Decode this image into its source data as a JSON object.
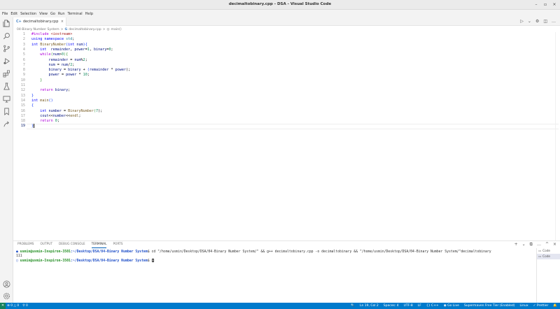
{
  "window": {
    "title": "decimaltobinary.cpp - DSA - Visual Studio Code"
  },
  "menu": [
    "File",
    "Edit",
    "Selection",
    "View",
    "Go",
    "Run",
    "Terminal",
    "Help"
  ],
  "tab": {
    "label": "decimaltobinary.cpp",
    "icon_text": "C+",
    "close": "×"
  },
  "breadcrumb": {
    "folder": "04-Binary Number System",
    "sep1": ">",
    "file_icon": "G",
    "file": "decimaltobinary.cpp",
    "sep2": ">",
    "symbol_icon": "◎",
    "symbol": "main()"
  },
  "editor": {
    "active_line": 19,
    "lines": [
      {
        "n": "1"
      },
      {
        "n": "2"
      },
      {
        "n": "3"
      },
      {
        "n": "4"
      },
      {
        "n": "5"
      },
      {
        "n": "6"
      },
      {
        "n": "7"
      },
      {
        "n": "8"
      },
      {
        "n": "9"
      },
      {
        "n": "10"
      },
      {
        "n": "11"
      },
      {
        "n": "12"
      },
      {
        "n": "13"
      },
      {
        "n": "14"
      },
      {
        "n": "15"
      },
      {
        "n": "16"
      },
      {
        "n": "17"
      },
      {
        "n": "18"
      },
      {
        "n": "19"
      }
    ],
    "code": {
      "l1_a": "#include",
      "l1_b": " <iostream>",
      "l2_a": "using",
      "l2_b": " namespace",
      "l2_c": " std",
      "l2_d": ";",
      "l3_a": "int",
      "l3_b": " BinaryNumber",
      "l3_c": "(",
      "l3_d": "int",
      "l3_e": " num",
      "l3_f": "){",
      "l4_a": "    int",
      "l4_b": "  remainder",
      "l4_c": ", ",
      "l4_d": "power",
      "l4_e": "=",
      "l4_f": "1",
      "l4_g": ", ",
      "l4_h": "binary",
      "l4_i": "=",
      "l4_j": "0",
      "l4_k": ";",
      "l5_a": "    while",
      "l5_b": "(",
      "l5_c": "num",
      "l5_d": ">",
      "l5_e": "0",
      "l5_f": "){",
      "l6_a": "        remainder",
      "l6_b": " = ",
      "l6_c": "num",
      "l6_d": "%",
      "l6_e": "2",
      "l6_f": ";",
      "l7_a": "        num",
      "l7_b": " = ",
      "l7_c": "num",
      "l7_d": "/",
      "l7_e": "2",
      "l7_f": ";",
      "l8_a": "        binary",
      "l8_b": " = ",
      "l8_c": "binary",
      "l8_d": " + ",
      "l8_e": "(",
      "l8_f": "remainder",
      "l8_g": " * ",
      "l8_h": "power",
      "l8_i": ");",
      "l9_a": "        power",
      "l9_b": " = ",
      "l9_c": "power",
      "l9_d": " * ",
      "l9_e": "10",
      "l9_f": ";",
      "l10_a": "    }",
      "l12_a": "    return",
      "l12_b": " binary",
      "l12_c": ";",
      "l13_a": "}",
      "l14_a": "int",
      "l14_b": " main",
      "l14_c": "()",
      "l15_a": "{",
      "l16_a": "    int",
      "l16_b": " number",
      "l16_c": " = ",
      "l16_d": "BinaryNumber",
      "l16_e": "(",
      "l16_f": "7",
      "l16_g": ");",
      "l17_a": "    cout",
      "l17_b": "<<",
      "l17_c": "number",
      "l17_d": "<<",
      "l17_e": "endl",
      "l17_f": ";",
      "l18_a": "    return",
      "l18_b": " 0",
      "l18_c": ";",
      "l19_a": "}"
    }
  },
  "panel": {
    "tabs": [
      "PROBLEMS",
      "OUTPUT",
      "DEBUG CONSOLE",
      "TERMINAL",
      "PORTS"
    ],
    "active_tab": "TERMINAL",
    "actions": [
      "+",
      "⌄",
      "⧉",
      "…",
      "^",
      "×"
    ],
    "terminal": {
      "line1_prompt": "usmin@usmin-Inspiron-3501",
      "line1_path": ":~/Desktop/DSA/04-Binary Number System",
      "line1_cmd": "$ cd \"/home/usmin/Desktop/DSA/04-Binary Number System/\" && g++ decimaltobinary.cpp -o decimaltobinary && \"/home/usmin/Desktop/DSA/04-Binary Number System/\"decimaltobinary",
      "line2": "111",
      "line3_prompt": "usmin@usmin-Inspiron-3501",
      "line3_path": ":~/Desktop/DSA/04-Binary Number System",
      "line3_cmd": "$ "
    },
    "terminal_list": [
      "Code",
      "Code"
    ]
  },
  "statusbar": {
    "remote": "✕",
    "errors": "⊗ 0 △ 0",
    "ports": "⚲ 0",
    "zoom_icon": "🔍",
    "position": "Ln 19, Col 2",
    "spaces": "Spaces: 4",
    "encoding": "UTF-8",
    "eol": "LF",
    "language": "{} C++",
    "golive": "◉ Go Live",
    "extension": "Supermaven Free Tier (Enabled)",
    "os": "Linux",
    "prettier": "✓ Prettier",
    "bell": "🔔"
  },
  "colors": {
    "statusbar": "#007acc",
    "remote": "#16825d",
    "accent": "#005fb8"
  }
}
